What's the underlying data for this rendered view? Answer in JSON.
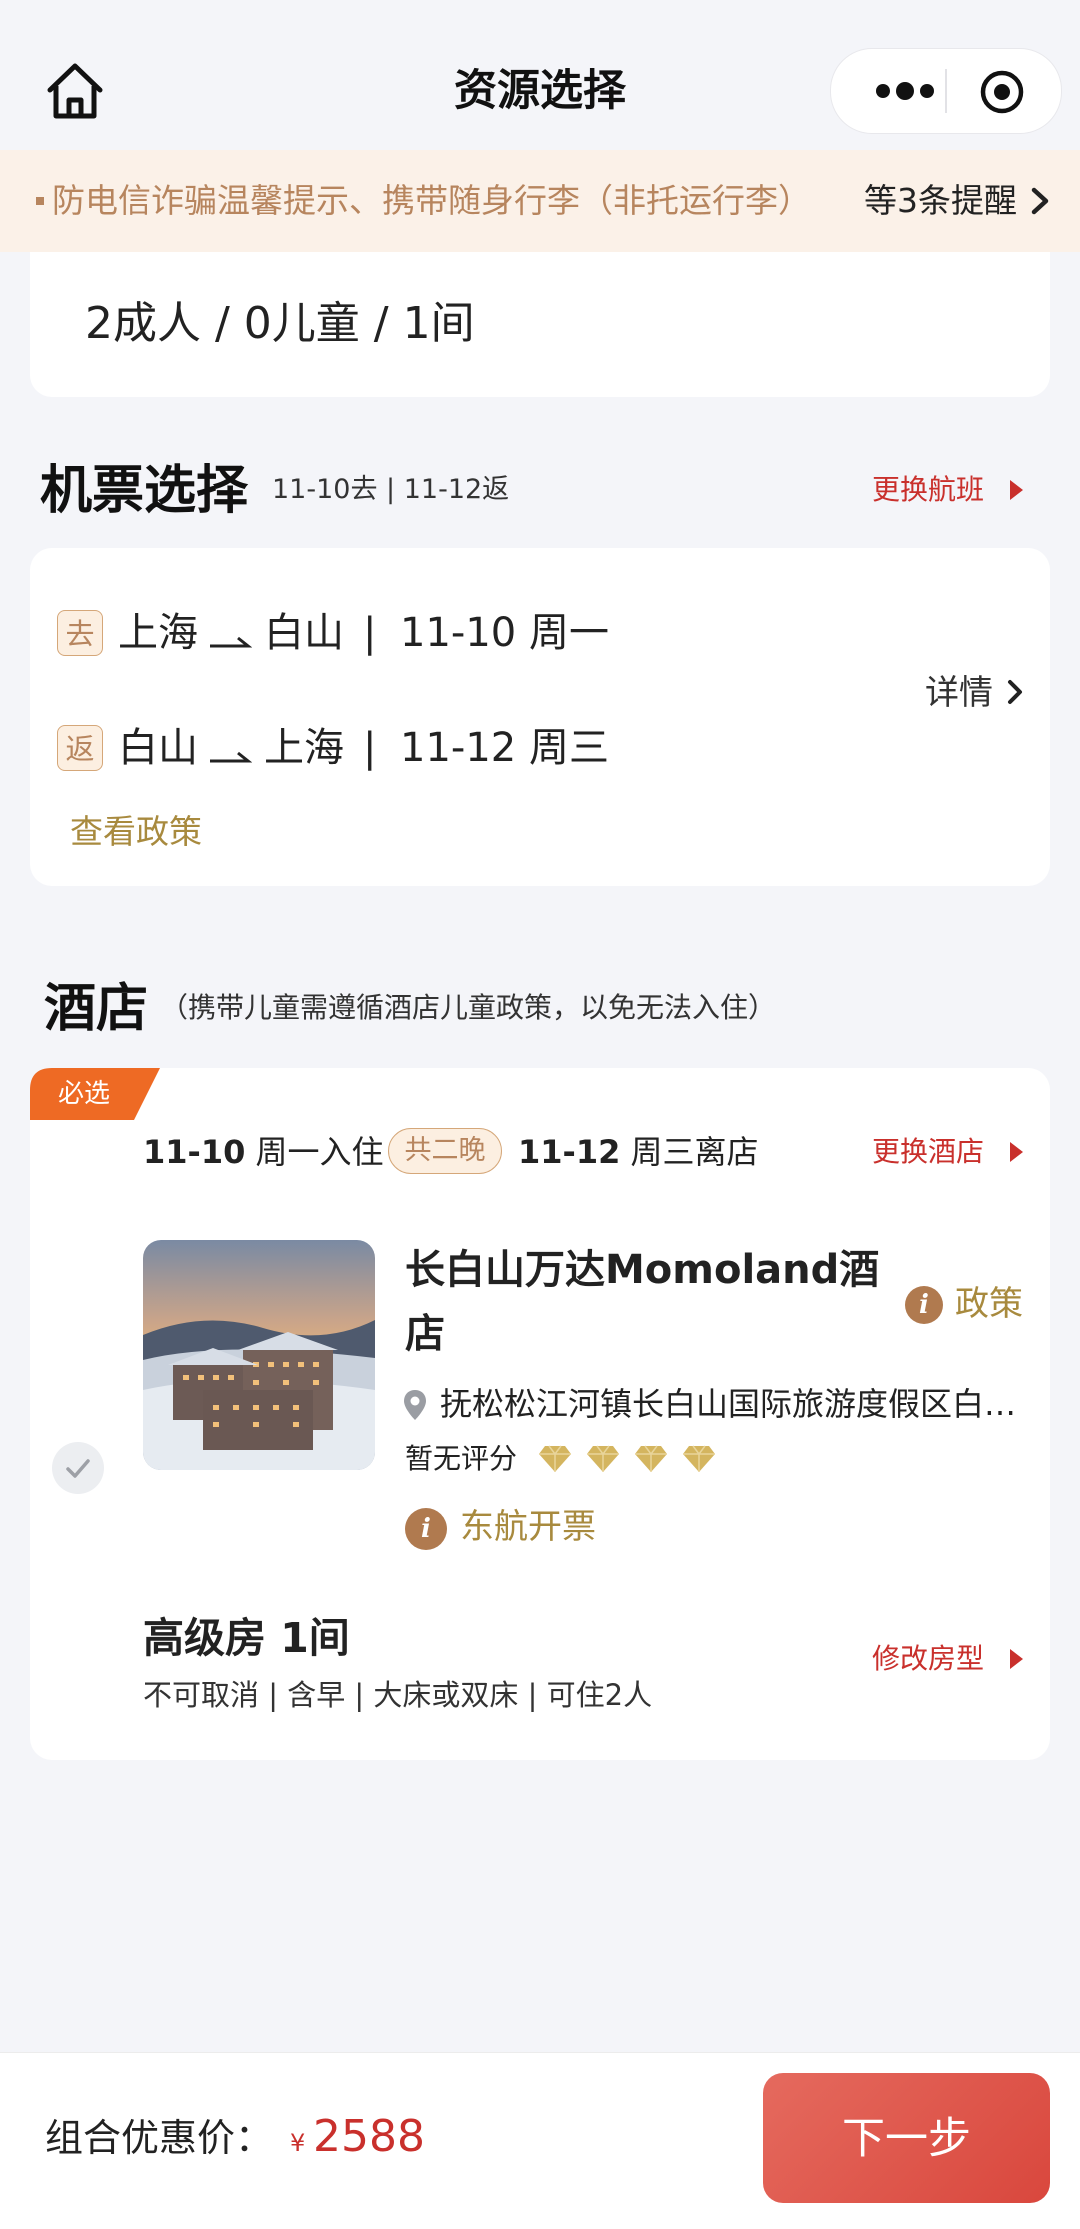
{
  "nav": {
    "title": "资源选择"
  },
  "notice": {
    "text": "防电信诈骗温馨提示、携带随身行李（非托运行李）",
    "more": "等3条提醒"
  },
  "guests": {
    "summary": "2成人 / 0儿童 / 1间"
  },
  "flight": {
    "title": "机票选择",
    "dates": "11-10去 | 11-12返",
    "change_label": "更换航班",
    "legs": [
      {
        "tag": "去",
        "from": "上海",
        "to": "白山",
        "sep": "|",
        "date": "11-10 周一"
      },
      {
        "tag": "返",
        "from": "白山",
        "to": "上海",
        "sep": "|",
        "date": "11-12 周三"
      }
    ],
    "detail_label": "详情",
    "policy_label": "查看政策"
  },
  "hotel": {
    "title": "酒店",
    "note": "（携带儿童需遵循酒店儿童政策，以免无法入住）",
    "must_label": "必选",
    "checkin_date": "11-10",
    "checkin_text": "周一入住",
    "nights": "共二晚",
    "checkout_date": "11-12",
    "checkout_text": "周三离店",
    "change_label": "更换酒店",
    "name": "长白山万达Momoland酒店",
    "policy_label": "政策",
    "address": "抚松松江河镇长白山国际旅游度假区白山市",
    "rating_text": "暂无评分",
    "diamonds": 4,
    "airline_label": "东航开票",
    "room_name": "高级房 1间",
    "room_desc": "不可取消 | 含早 | 大床或双床 | 可住2人",
    "room_change_label": "修改房型"
  },
  "footer": {
    "price_label": "组合优惠价：",
    "currency": "¥",
    "price": "2588",
    "next_label": "下一步"
  },
  "colors": {
    "accent_red": "#c9302c",
    "gold": "#a88a3e",
    "tag_bg": "#fcefe1",
    "button": "#dc4d42"
  }
}
